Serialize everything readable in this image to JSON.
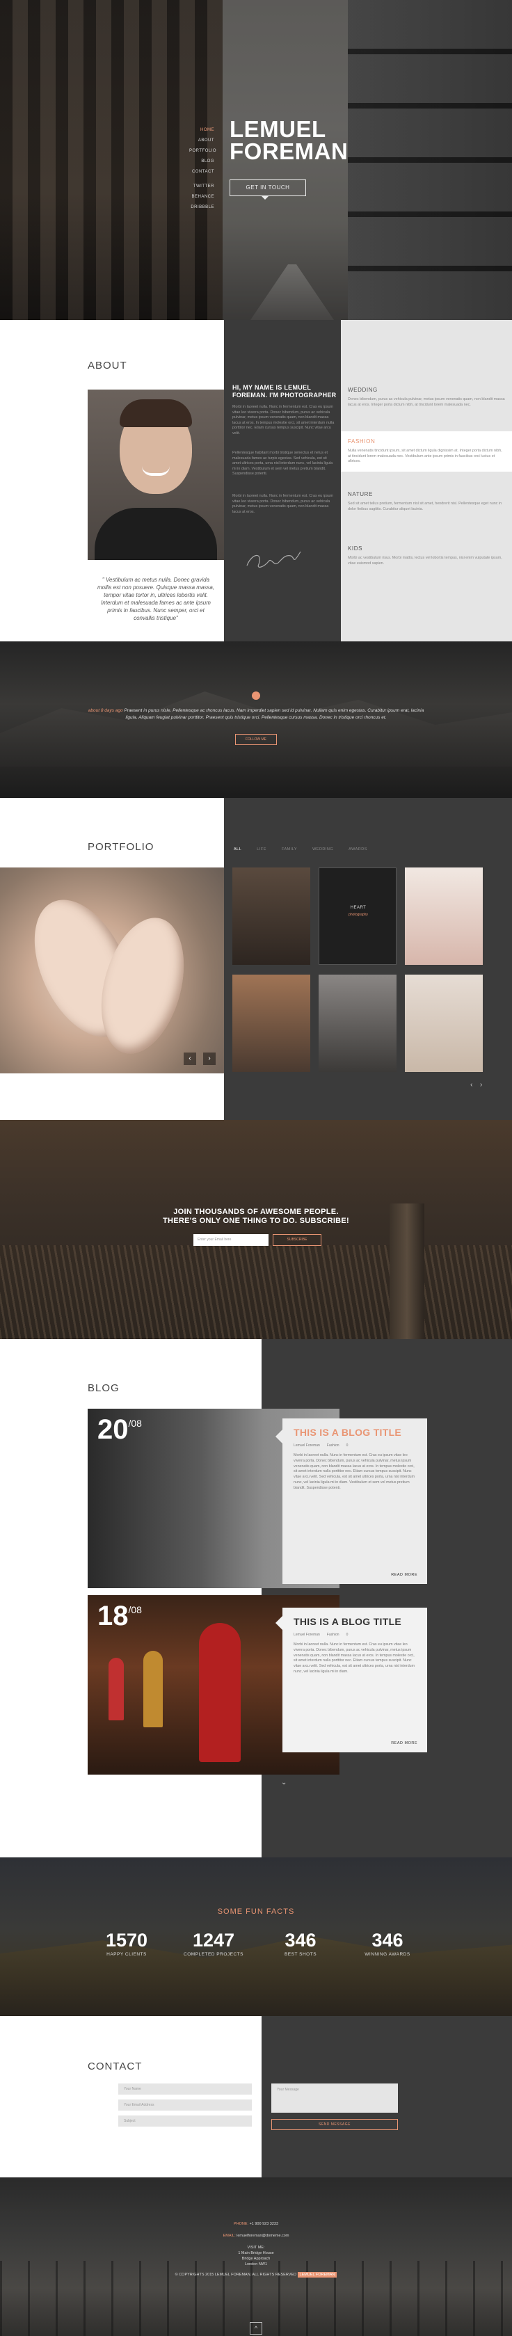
{
  "colors": {
    "accent": "#e99573",
    "dark": "#3b3b3b",
    "light": "#e5e5e5"
  },
  "hero": {
    "nav": [
      "HOME",
      "ABOUT",
      "PORTFOLIO",
      "BLOG",
      "CONTACT",
      "TWITTER",
      "BEHANCE",
      "DRIBBBLE"
    ],
    "name_line1": "LEMUEL",
    "name_line2": "FOREMAN",
    "cta": "GET IN TOUCH"
  },
  "about": {
    "title": "ABOUT",
    "heading": "HI, MY NAME IS LEMUEL FOREMAN. I'M PHOTOGRAPHER",
    "para1": "Morbi in laoreet nulla. Nunc in fermentum est. Cras eu ipsum vitae leo viverra porta. Donec bibendum, purus ac vehicula pulvinar, metus ipsum venenatis quam, non blandit massa lacus at eros. In tempus molestie orci, sit amet interdum nulla porttitor nec. Etiam cursus tempus suscipit. Nunc vitae arcu velit.",
    "para2": "Pellentesque habitant morbi tristique senectus et netus et malesuada fames ac turpis egestas. Sed vehicula, est sit amet ultrices porta, urna nisl interdum nunc, vel lacinia ligula mi in diam. Vestibulum et sem vel metus pretium blandit. Suspendisse potenti.",
    "para3": "Morbi in laoreet nulla. Nunc in fermentum est. Cras eu ipsum vitae leo viverra porta. Donec bibendum, purus ac vehicula pulvinar, metus ipsum venenatis quam, non blandit massa lacus at eros.",
    "quote": "\" Vestibulum ac metus nulla. Donec gravida mollis est non posuere. Quisque massa massa, tempor vitae tortor in, ultrices lobortis velit. Interdum et malesuada fames ac ante ipsum primis in faucibus. Nunc semper, orci et convallis tristique\"",
    "categories": [
      {
        "title": "WEDDING",
        "desc": "Donec bibendum, purus ac vehicula pulvinar, metus ipsum venenatis quam, non blandit massa lacus at eros. Integer porta dictum nibh, at tincidunt lorem malesuada nec."
      },
      {
        "title": "FASHION",
        "desc": "Nulla venenatis tincidunt ipsum, sit amet dictum ligula dignissim at. Integer porta dictum nibh, at tincidunt lorem malesuada nec. Vestibulum ante ipsum primis in faucibus orci luctus et ultrices."
      },
      {
        "title": "NATURE",
        "desc": "Sed sit amet tellus pretium, fermentum nisl sit amet, hendrerit nisl. Pellentesque eget nunc in dolor finibus sagittis. Curabitur aliquet lacinia."
      },
      {
        "title": "KIDS",
        "desc": "Morbi ac vestibulum risus. Morbi mattis, lectus vel lobortis tempus, nisi enim vulputate ipsum, vitae euismod sapien."
      }
    ]
  },
  "parallax1": {
    "accent_text": "about 8 days ago",
    "text": "Praesent in purus nisle. Pellentesque ac rhoncus lacus. Nam imperdiet sapien sed id pulvinar. Nullam quis enim egestas. Curabitur ipsum erat, lacinia ligula. Aliquam feugiat pulvinar porttitor. Praesent quis tristique orci. Pellentesque cursus massa. Donec in tristique orci rhoncus et.",
    "button": "FOLLOW ME"
  },
  "portfolio": {
    "title": "PORTFOLIO",
    "filters": [
      "ALL",
      "LIFE",
      "FAMILY",
      "WEDDING",
      "AWARDS"
    ],
    "hover_title": "HEART",
    "hover_sub": "photography"
  },
  "subscribe": {
    "title_line1": "JOIN THOUSANDS OF AWESOME PEOPLE.",
    "title_line2": "THERE'S ONLY ONE THING TO DO. SUBSCRIBE!",
    "placeholder": "Enter your Email here",
    "button": "SUBSCRIBE"
  },
  "blog": {
    "title": "BLOG",
    "posts": [
      {
        "day": "20",
        "month": "08",
        "title": "THIS IS A BLOG TITLE",
        "author": "Lemuel Foreman",
        "tag": "Fashion",
        "comments": "0",
        "body": "Morbi in laoreet nulla. Nunc in fermentum est. Cras eu ipsum vitae leo viverra porta. Donec bibendum, purus ac vehicula pulvinar, metus ipsum venenatis quam, non blandit massa lacus at eros. In tempus molestie orci, sit amet interdum nulla porttitor nec. Etiam cursus tempus suscipit. Nunc vitae arcu velit. Sed vehicula, est sit amet ultrices porta, urna nisl interdum nunc, vel lacinia ligula mi in diam. Vestibulum et sem vel metus pretium blandit. Suspendisse potenti.",
        "more": "READ MORE"
      },
      {
        "day": "18",
        "month": "08",
        "title": "THIS IS A BLOG TITLE",
        "author": "Lemuel Foreman",
        "tag": "Fashion",
        "comments": "0",
        "body": "Morbi in laoreet nulla. Nunc in fermentum est. Cras eu ipsum vitae leo viverra porta. Donec bibendum, purus ac vehicula pulvinar, metus ipsum venenatis quam, non blandit massa lacus at eros. In tempus molestie orci, sit amet interdum nulla porttitor nec. Etiam cursus tempus suscipit. Nunc vitae arcu velit. Sed vehicula, est sit amet ultrices porta, urna nisl interdum nunc, vel lacinia ligula mi in diam.",
        "more": "READ MORE"
      }
    ]
  },
  "facts": {
    "title_plain": "SOME",
    "title_accent": "FUN FACTS",
    "items": [
      {
        "value": "1570",
        "label": "HAPPY CLIENTS"
      },
      {
        "value": "1247",
        "label": "COMPLETED PROJECTS"
      },
      {
        "value": "346",
        "label": "BEST SHOTS"
      },
      {
        "value": "346",
        "label": "WINNING AWARDS"
      }
    ]
  },
  "contact": {
    "title": "CONTACT",
    "name_placeholder": "Your Name",
    "email_placeholder": "Your Email Address",
    "subject_placeholder": "Subject",
    "message_placeholder": "Your Message",
    "send": "SEND MESSAGE"
  },
  "footer": {
    "phone_label": "PHONE:",
    "phone": "+1 900 923 3233",
    "email_label": "EMAIL:",
    "email": "lemuelforeman@domeme.com",
    "address1": "VISIT ME:",
    "address2": "1 Main Bridge House",
    "address3": "Bridge Approach",
    "address4": "London NW1",
    "copyright": "© COPYRIGHTS 2015 LEMUEL FOREMAN. ALL RIGHTS RESERVED",
    "tag": "LEMUEL FOREMAN",
    "totop": "^"
  }
}
